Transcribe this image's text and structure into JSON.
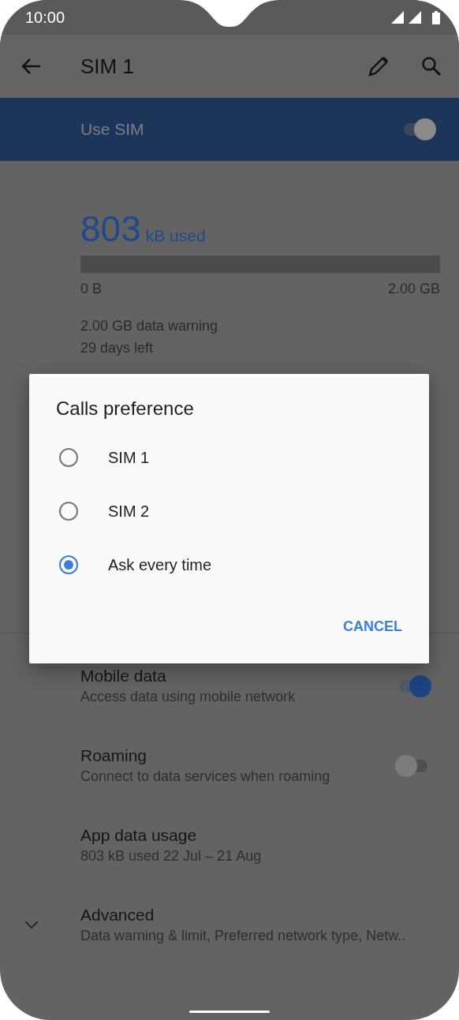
{
  "status_bar": {
    "time": "10:00"
  },
  "app_bar": {
    "title": "SIM 1"
  },
  "use_sim": {
    "label": "Use SIM",
    "on": true
  },
  "usage": {
    "amount": "803",
    "unit": "kB used",
    "level": 0,
    "min_label": "0 B",
    "max_label": "2.00 GB",
    "warning": "2.00 GB data warning",
    "days_left": "29 days left"
  },
  "settings": [
    {
      "kind": "toggle",
      "title": "Mobile data",
      "subtitle": "Access data using mobile network",
      "on": true
    },
    {
      "kind": "toggle",
      "title": "Roaming",
      "subtitle": "Connect to data services when roaming",
      "on": false
    },
    {
      "kind": "plain",
      "title": "App data usage",
      "subtitle": "803 kB used 22 Jul – 21 Aug"
    },
    {
      "kind": "expand",
      "title": "Advanced",
      "subtitle": "Data warning & limit, Preferred network type, Netw..",
      "expanded": false
    }
  ],
  "dialog": {
    "title": "Calls preference",
    "options": [
      {
        "label": "SIM 1",
        "selected": false
      },
      {
        "label": "SIM 2",
        "selected": false
      },
      {
        "label": "Ask every time",
        "selected": true
      }
    ],
    "button": "CANCEL"
  }
}
